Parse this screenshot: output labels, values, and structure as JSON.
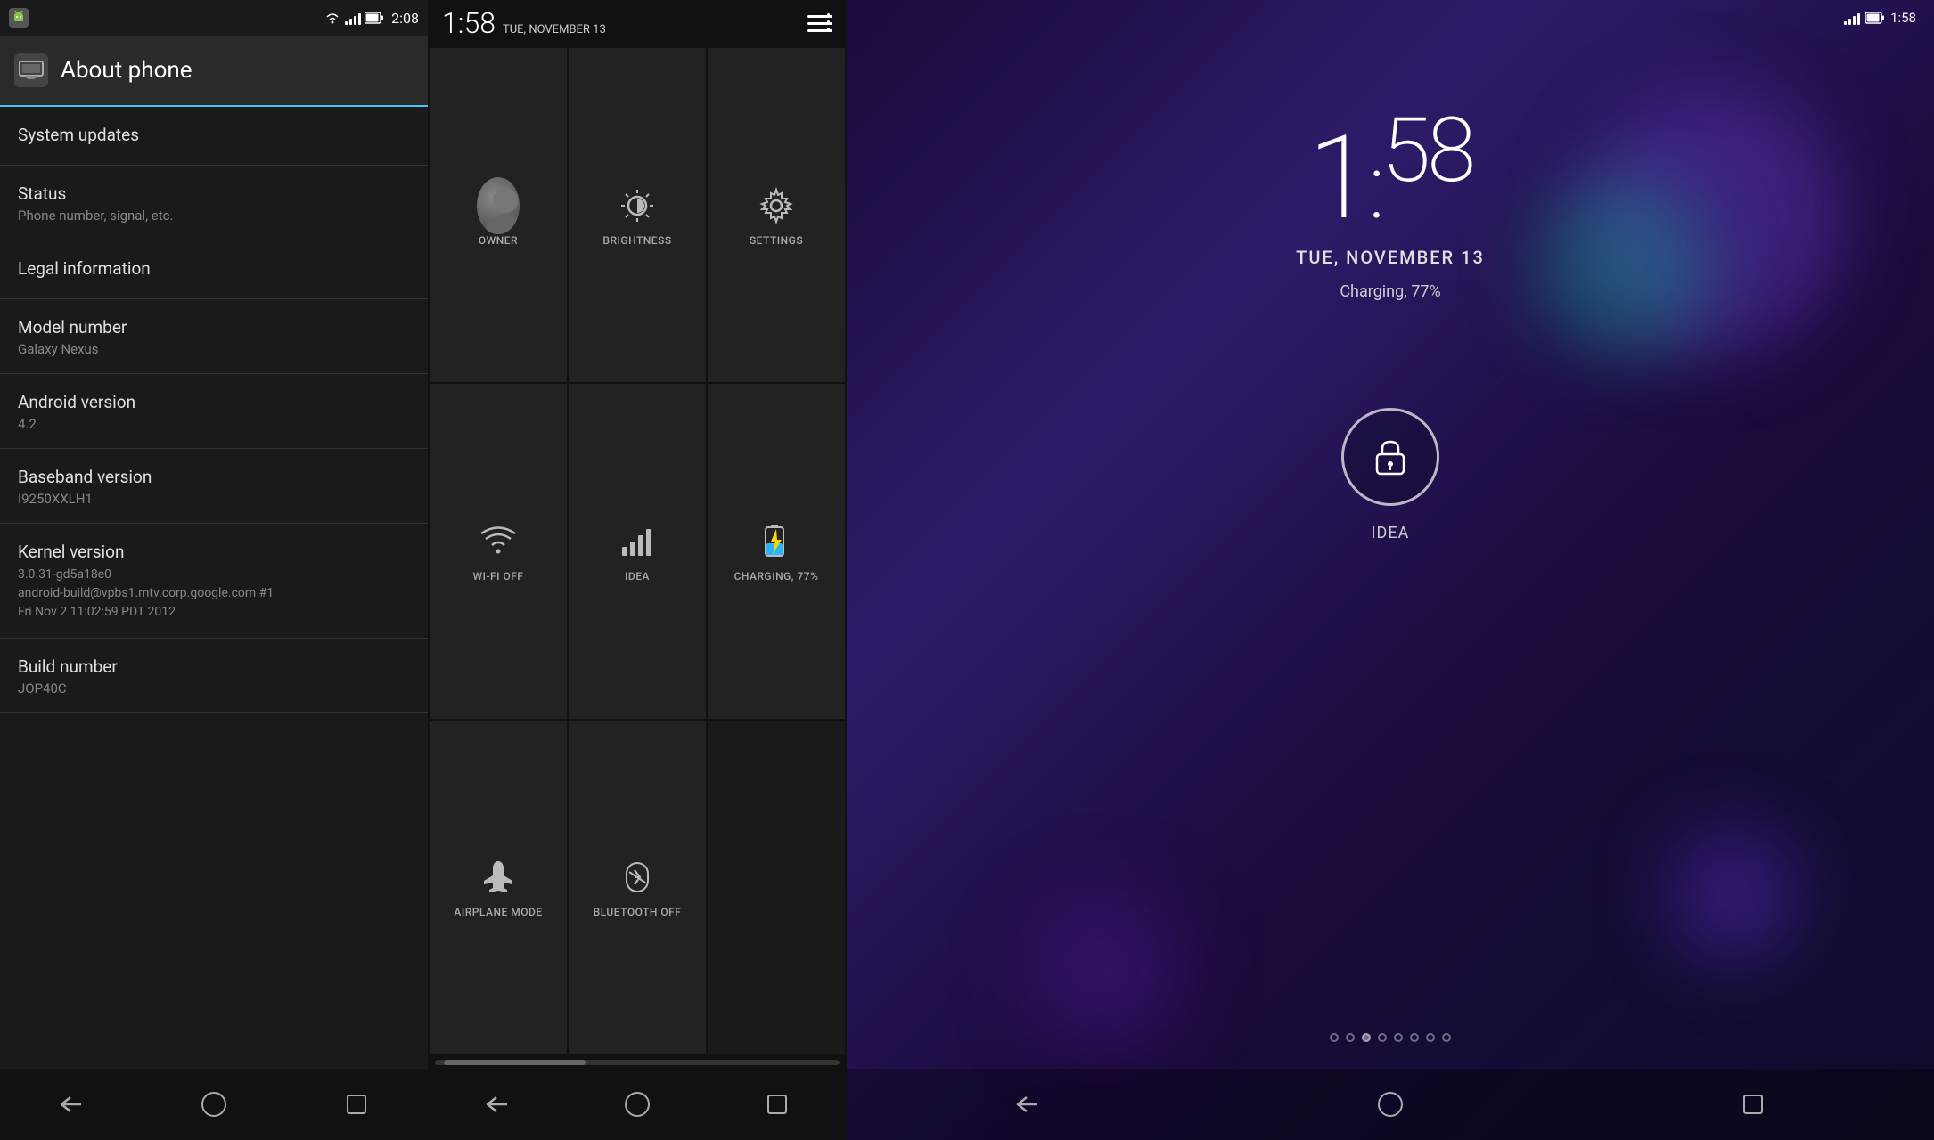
{
  "panel1": {
    "statusBar": {
      "time": "2:08",
      "batteryIcon": "battery-icon",
      "signalIcon": "signal-icon"
    },
    "header": {
      "title": "About phone",
      "icon": "about-phone-icon"
    },
    "items": [
      {
        "title": "System updates",
        "subtitle": ""
      },
      {
        "title": "Status",
        "subtitle": "Phone number, signal, etc."
      },
      {
        "title": "Legal information",
        "subtitle": ""
      },
      {
        "title": "Model number",
        "subtitle": "Galaxy Nexus"
      },
      {
        "title": "Android version",
        "subtitle": "4.2"
      },
      {
        "title": "Baseband version",
        "subtitle": "I9250XXLH1"
      },
      {
        "title": "Kernel version",
        "multiline": "3.0.31-gd5a18e0\nandroid-build@vpbs1.mtv.corp.google.com #1\nFri Nov 2 11:02:59 PDT 2012"
      },
      {
        "title": "Build number",
        "subtitle": "JOP40C"
      }
    ],
    "nav": {
      "back": "back-button",
      "home": "home-button",
      "recent": "recent-button"
    }
  },
  "panel2": {
    "statusBar": {
      "time": "1:58",
      "date": "TUE, NOVEMBER 13"
    },
    "menuIcon": "menu-icon",
    "tiles": [
      {
        "id": "owner",
        "label": "OWNER",
        "iconType": "avatar"
      },
      {
        "id": "brightness",
        "label": "BRIGHTNESS",
        "iconType": "brightness"
      },
      {
        "id": "settings",
        "label": "SETTINGS",
        "iconType": "settings"
      },
      {
        "id": "wifi",
        "label": "WI-FI OFF",
        "iconType": "wifi"
      },
      {
        "id": "idea",
        "label": "IDEA",
        "iconType": "signal"
      },
      {
        "id": "charging",
        "label": "CHARGING, 77%",
        "iconType": "battery-charging"
      },
      {
        "id": "airplane",
        "label": "AIRPLANE MODE",
        "iconType": "airplane"
      },
      {
        "id": "bluetooth",
        "label": "BLUETOOTH OFF",
        "iconType": "bluetooth"
      }
    ],
    "nav": {
      "back": "back-button",
      "home": "home-button",
      "recent": "recent-button"
    }
  },
  "panel3": {
    "statusBar": {
      "time": "1:58",
      "signal": "signal-icon",
      "battery": "battery-icon"
    },
    "time": "1:58",
    "timeHour": "1",
    "timeMinutes": "58",
    "date": "TUE, NOVEMBER 13",
    "chargingText": "Charging, 77%",
    "lockIcon": "lock-icon",
    "carrier": "IDEA",
    "nav": {
      "back": "back-button",
      "home": "home-button",
      "recent": "recent-button"
    }
  }
}
